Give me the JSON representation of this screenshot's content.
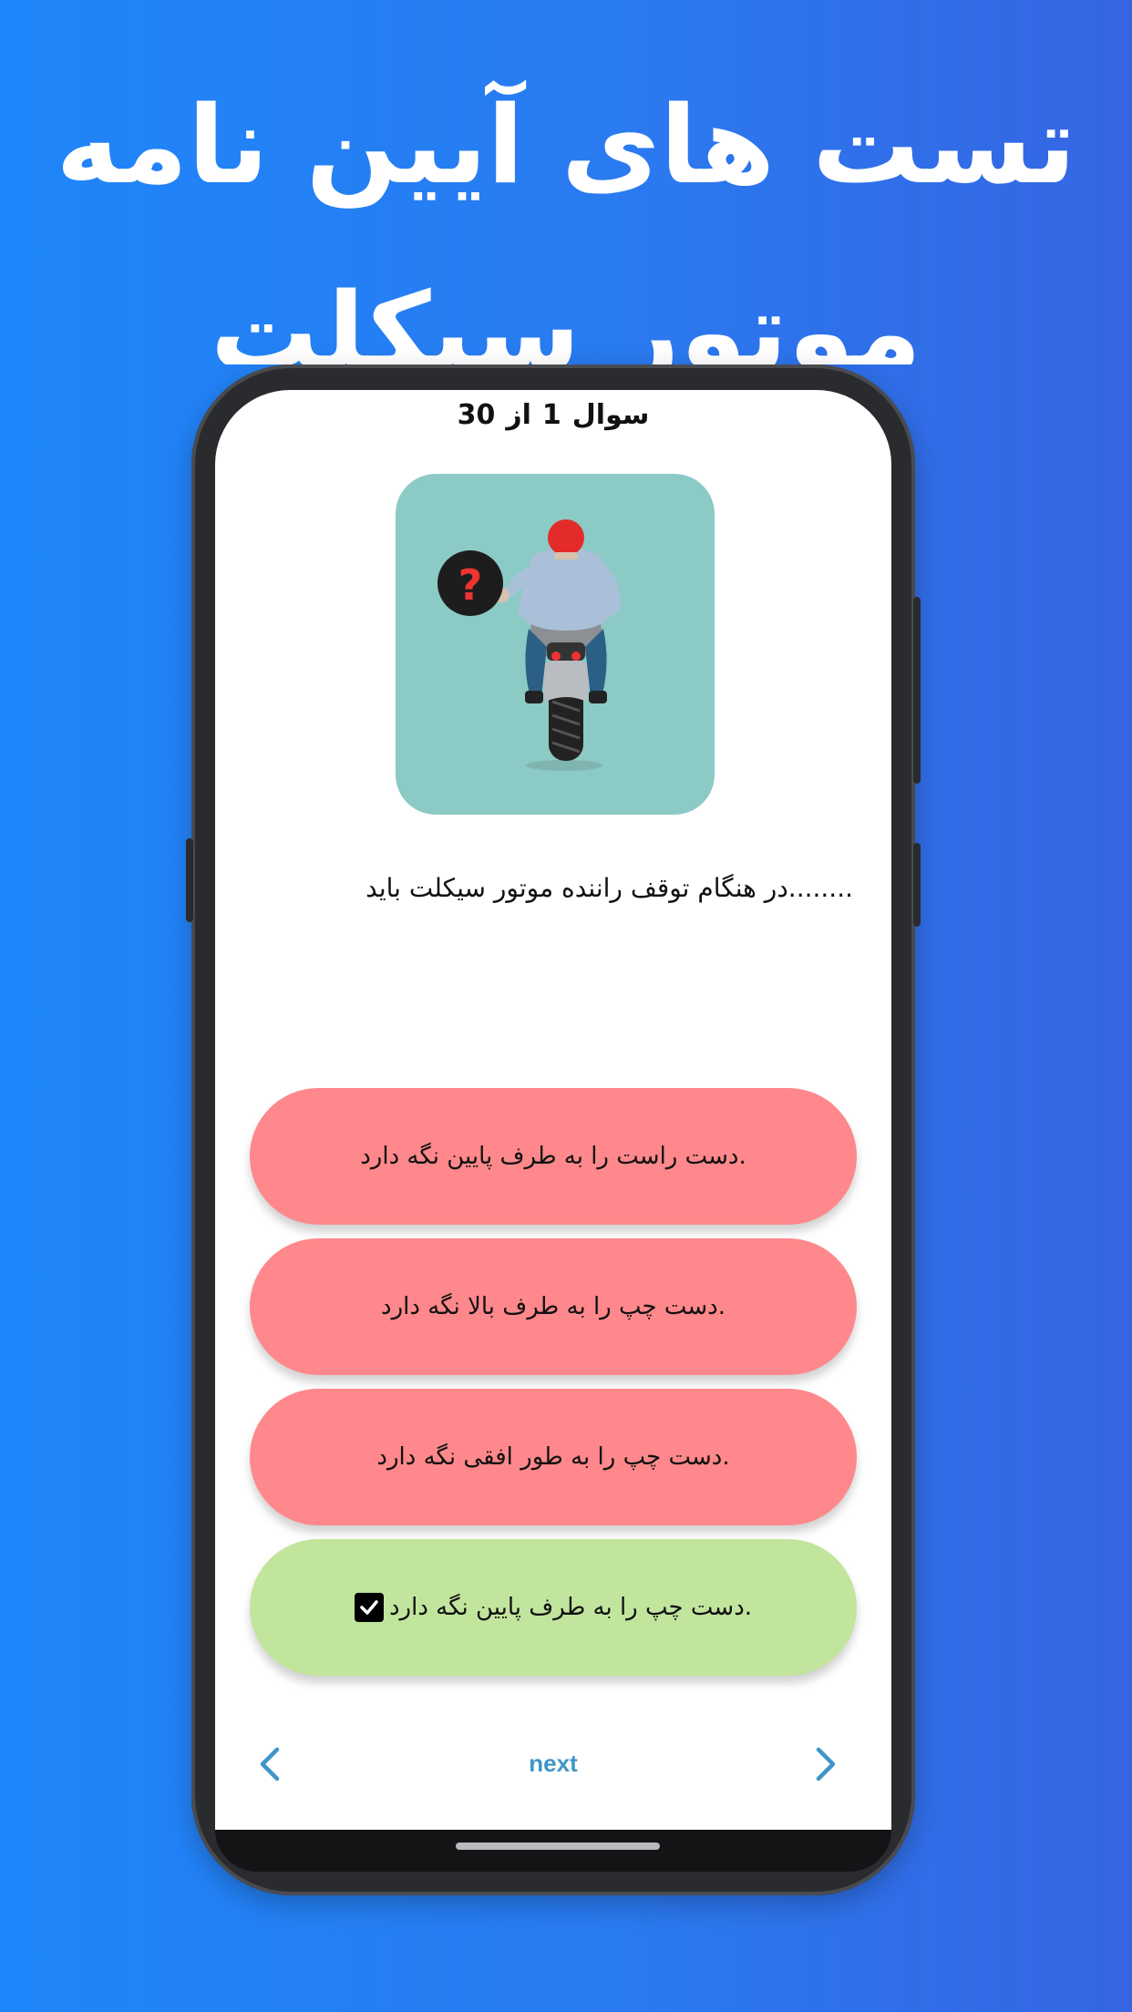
{
  "hero": {
    "title_line1": "تست های آیین نامه",
    "title_line2": "موتور سیکلت"
  },
  "quiz": {
    "counter_word": "سوال",
    "current": "1",
    "of_word": "از",
    "total": "30",
    "question": "........در هنگام توقف راننده موتور سیکلت باید",
    "answers": [
      {
        "text": ".دست راست را به طرف پایین نگه دارد",
        "state": "wrong"
      },
      {
        "text": ".دست چپ را به طرف بالا نگه دارد",
        "state": "wrong"
      },
      {
        "text": ".دست چپ را به طور افقی نگه دارد",
        "state": "wrong"
      },
      {
        "text": ".دست چپ را به طرف پایین نگه دارد",
        "state": "correct"
      }
    ],
    "next_label": "next"
  },
  "colors": {
    "wrong": "#fe888b",
    "correct": "#c2e59d",
    "illustration_bg": "#8ccac6",
    "nav_accent": "#3f95c9"
  },
  "icons": {
    "prev": "chevron-left-icon",
    "next": "chevron-right-icon",
    "check": "checkbox-checked-icon"
  }
}
